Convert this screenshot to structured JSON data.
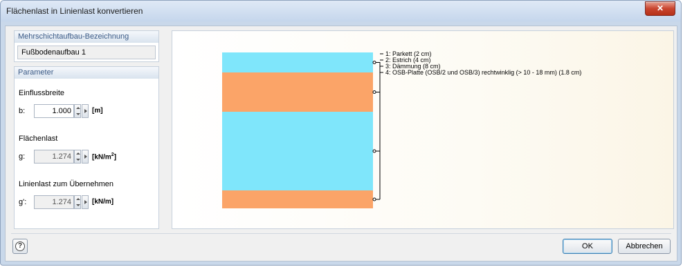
{
  "window": {
    "title": "Flächenlast in Linienlast konvertieren",
    "close_glyph": "✕"
  },
  "layer_group": {
    "header": "Mehrschichtaufbau-Bezeichnung",
    "name": "Fußbodenaufbau 1"
  },
  "params": {
    "header": "Parameter",
    "width": {
      "title": "Einflussbreite",
      "symbol": "b:",
      "value": "1.000",
      "unit": "[m]"
    },
    "area_load": {
      "title": "Flächenlast",
      "symbol": "g:",
      "value": "1.274",
      "unit_pre": "[kN/m",
      "unit_sup": "2",
      "unit_post": "]"
    },
    "line_load": {
      "title": "Linienlast zum Übernehmen",
      "symbol": "g':",
      "value": "1.274",
      "unit": "[kN/m]"
    }
  },
  "layers": [
    {
      "label": "1: Parkett (2 cm)",
      "color": "#7fe6fb",
      "thickness_cm": 2
    },
    {
      "label": "2: Estrich (4 cm)",
      "color": "#fba468",
      "thickness_cm": 4
    },
    {
      "label": "3: Dämmung (8 cm)",
      "color": "#7fe6fb",
      "thickness_cm": 8
    },
    {
      "label": "4: OSB-Platte (OSB/2 und OSB/3) rechtwinklig (> 10 - 18 mm) (1.8 cm)",
      "color": "#fba468",
      "thickness_cm": 1.8
    }
  ],
  "buttons": {
    "ok": "OK",
    "cancel": "Abbrechen",
    "help_glyph": "?"
  }
}
